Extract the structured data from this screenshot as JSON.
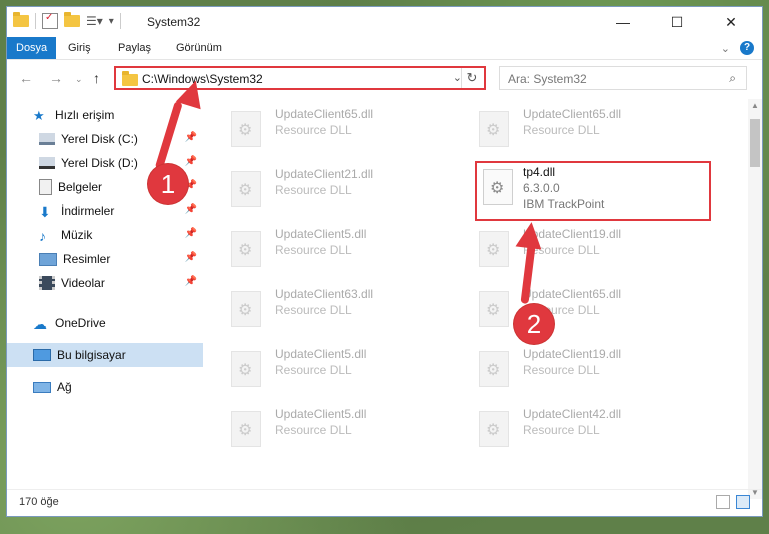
{
  "window": {
    "title": "System32"
  },
  "ribbon": {
    "tabs": [
      "Dosya",
      "Giriş",
      "Paylaş",
      "Görünüm"
    ],
    "help": "?"
  },
  "nav": {
    "address": "C:\\Windows\\System32",
    "search_placeholder": "Ara: System32"
  },
  "sidebar": {
    "items": [
      {
        "label": "Hızlı erişim",
        "icon": "star-icon"
      },
      {
        "label": "Yerel Disk (C:)",
        "icon": "drive-icon"
      },
      {
        "label": "Yerel Disk (D:)",
        "icon": "drive-icon"
      },
      {
        "label": "Belgeler",
        "icon": "documents-icon"
      },
      {
        "label": "İndirmeler",
        "icon": "download-icon"
      },
      {
        "label": "Müzik",
        "icon": "music-icon"
      },
      {
        "label": "Resimler",
        "icon": "pictures-icon"
      },
      {
        "label": "Videolar",
        "icon": "video-icon"
      },
      {
        "label": "OneDrive",
        "icon": "cloud-icon"
      },
      {
        "label": "Bu bilgisayar",
        "icon": "computer-icon"
      },
      {
        "label": "Ağ",
        "icon": "network-icon"
      }
    ]
  },
  "files": [
    {
      "name": "UpdateClient65.dll",
      "desc": "Resource DLL"
    },
    {
      "name": "UpdateClient65.dll",
      "desc": "Resource DLL"
    },
    {
      "name": "UpdateClient21.dll",
      "desc": "Resource DLL"
    },
    {
      "name": "tp4.dll",
      "desc": "6.3.0.0",
      "desc2": "IBM TrackPoint"
    },
    {
      "name": "UpdateClient5.dll",
      "desc": "Resource DLL"
    },
    {
      "name": "UpdateClient19.dll",
      "desc": "Resource DLL"
    },
    {
      "name": "UpdateClient63.dll",
      "desc": "Resource DLL"
    },
    {
      "name": "UpdateClient65.dll",
      "desc": "Resource DLL"
    },
    {
      "name": "UpdateClient5.dll",
      "desc": "Resource DLL"
    },
    {
      "name": "UpdateClient19.dll",
      "desc": "Resource DLL"
    },
    {
      "name": "UpdateClient5.dll",
      "desc": "Resource DLL"
    },
    {
      "name": "UpdateClient42.dll",
      "desc": "Resource DLL"
    }
  ],
  "status": {
    "count": "170 öğe"
  },
  "annotations": {
    "badge1": "1",
    "badge2": "2"
  },
  "colors": {
    "accent": "#1979ca",
    "highlight": "#e0383e"
  }
}
